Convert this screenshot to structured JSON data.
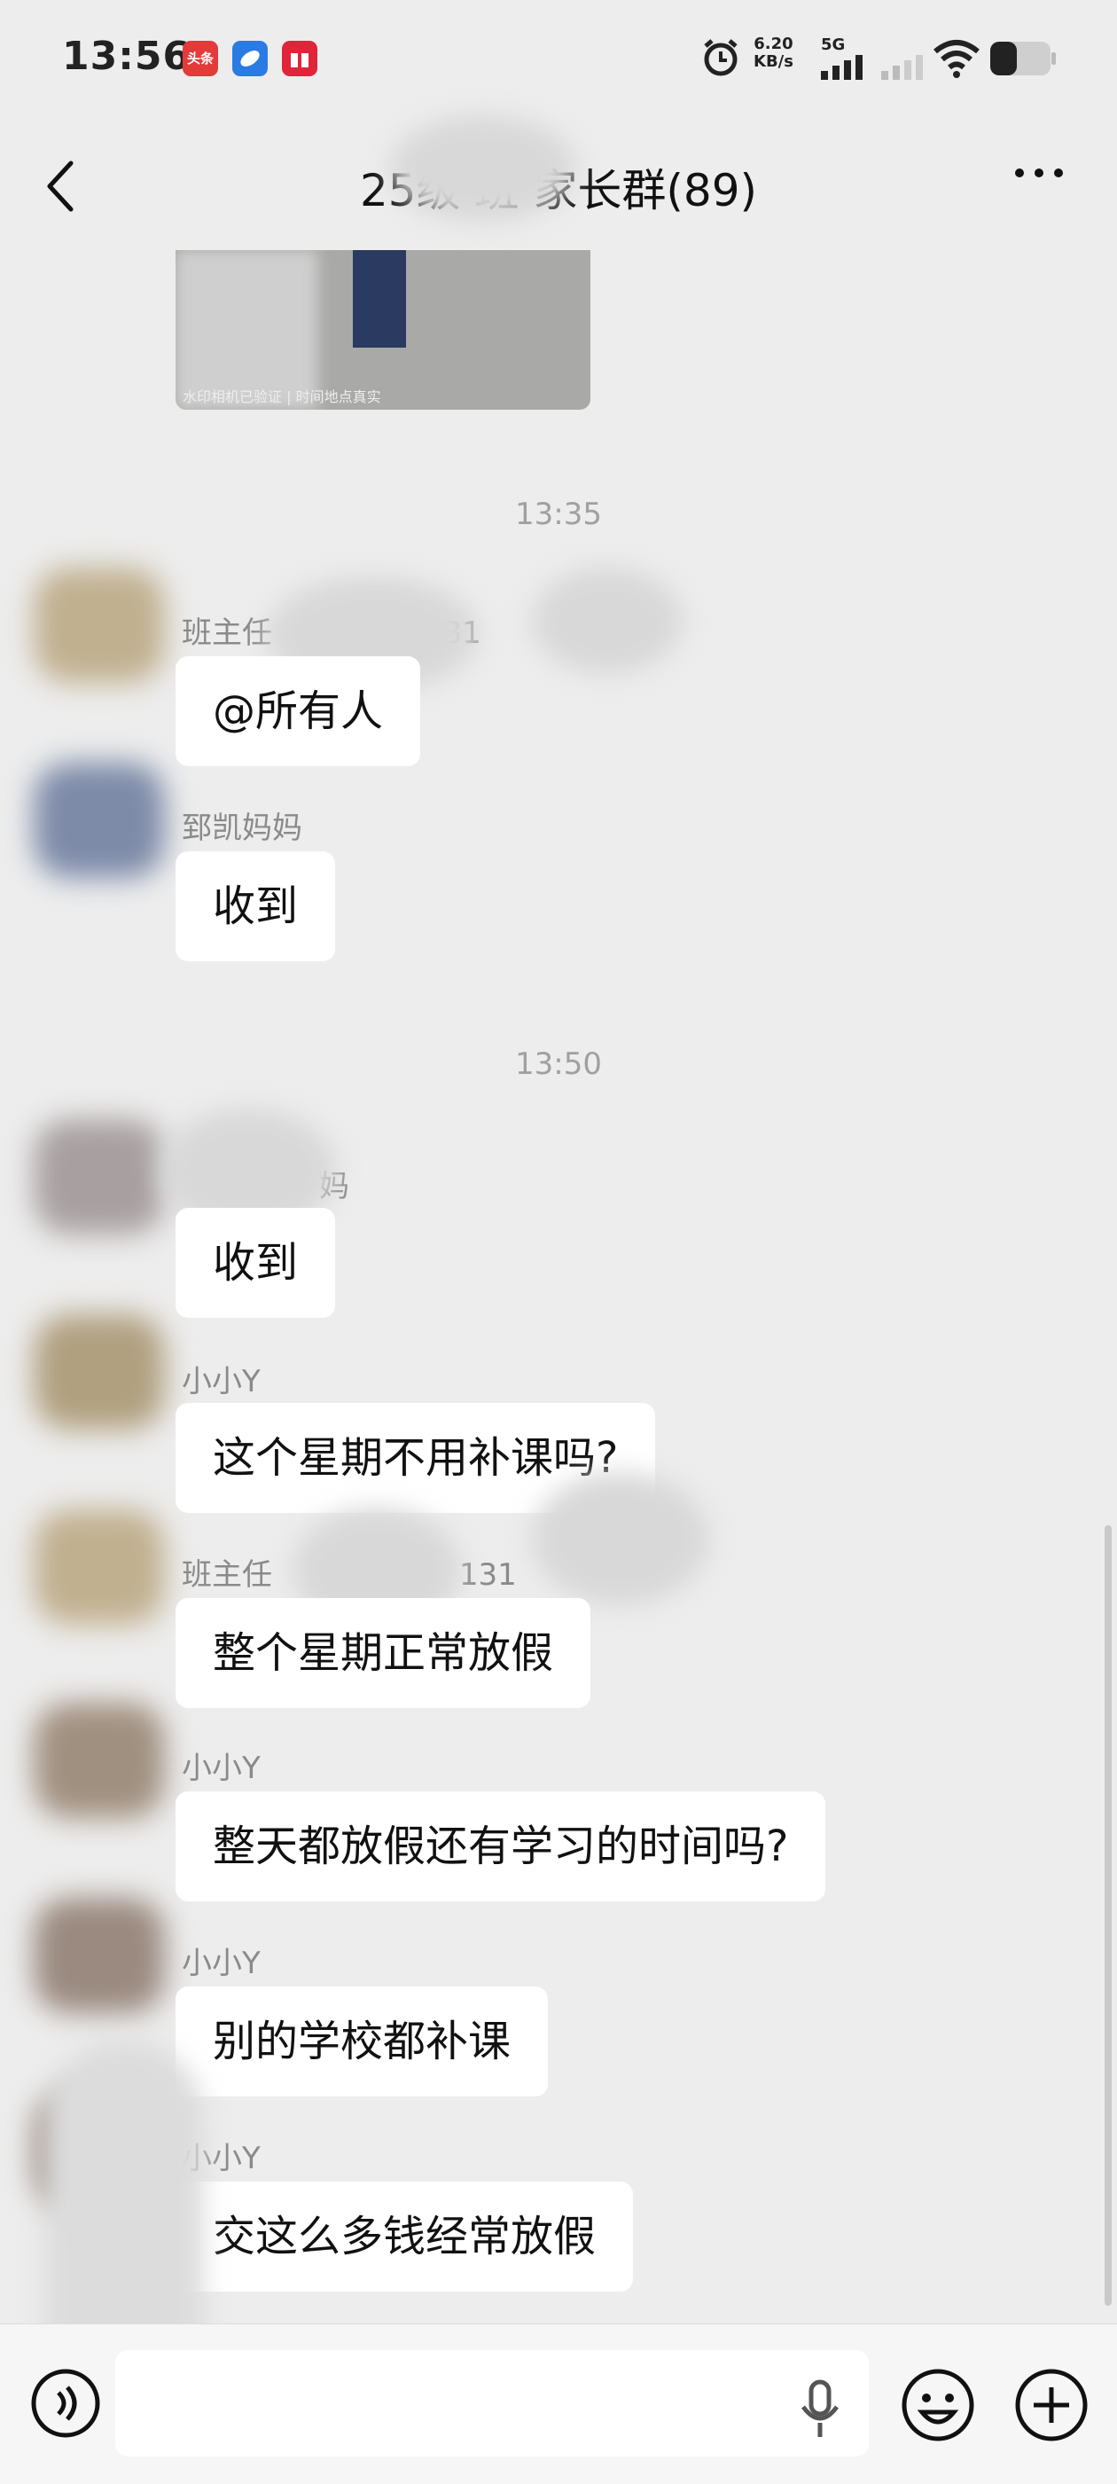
{
  "status_bar": {
    "time": "13:56",
    "app_icon_1": "头条",
    "net_speed_value": "6.20",
    "net_speed_unit": "KB/s",
    "network_type": "5G"
  },
  "header": {
    "title": "25级 班 家长群(89)"
  },
  "chat": {
    "image_watermark": "水印相机已验证 | 时间地点真实",
    "timestamps": [
      "13:35",
      "13:50"
    ],
    "messages": [
      {
        "sender": "班主任",
        "sender_suffix": "131",
        "text": "@所有人"
      },
      {
        "sender": "郅凯妈妈",
        "text": "收到"
      },
      {
        "sender": "妈",
        "text": "收到"
      },
      {
        "sender": "小小Y",
        "text": "这个星期不用补课吗?"
      },
      {
        "sender": "班主任",
        "sender_suffix": "131",
        "text": "整个星期正常放假"
      },
      {
        "sender": "小小Y",
        "text": "整天都放假还有学习的时间吗?"
      },
      {
        "sender": "小小Y",
        "text": "别的学校都补课"
      },
      {
        "sender": "小小Y",
        "text": "交这么多钱经常放假"
      }
    ]
  },
  "icons": {
    "back": "chevron-left-icon",
    "more": "more-dots-icon",
    "voice": "voice-icon",
    "mic": "microphone-icon",
    "emoji": "emoji-icon",
    "plus": "plus-icon"
  },
  "colors": {
    "background": "#ededed",
    "bubble": "#ffffff",
    "timestamp": "#a0a0a0",
    "sender": "#8a8a8a"
  }
}
